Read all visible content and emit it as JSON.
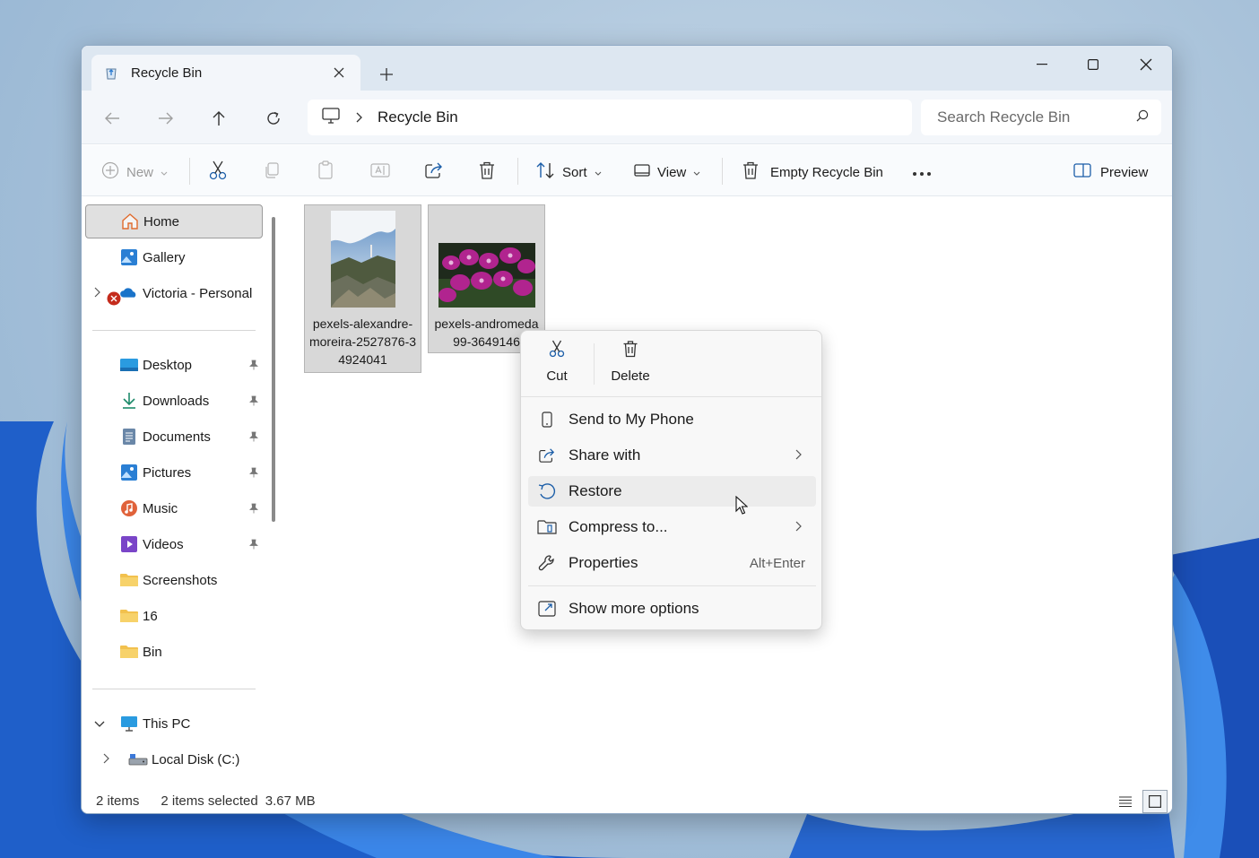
{
  "window": {
    "tab_title": "Recycle Bin",
    "breadcrumb": "Recycle Bin",
    "search_placeholder": "Search Recycle Bin"
  },
  "toolbar": {
    "new_label": "New",
    "sort_label": "Sort",
    "view_label": "View",
    "empty_label": "Empty Recycle Bin",
    "preview_label": "Preview"
  },
  "sidebar": {
    "home": "Home",
    "gallery": "Gallery",
    "onedrive": "Victoria - Personal",
    "desktop": "Desktop",
    "downloads": "Downloads",
    "documents": "Documents",
    "pictures": "Pictures",
    "music": "Music",
    "videos": "Videos",
    "screenshots": "Screenshots",
    "folder16": "16",
    "bin": "Bin",
    "thispc": "This PC",
    "localdisk": "Local Disk (C:)"
  },
  "files": [
    {
      "name": "pexels-alexandre-moreira-2527876-34924041"
    },
    {
      "name": "pexels-andromeda99-3649146"
    }
  ],
  "context_menu": {
    "cut": "Cut",
    "delete": "Delete",
    "send_phone": "Send to My Phone",
    "share": "Share with",
    "restore": "Restore",
    "compress": "Compress to...",
    "properties": "Properties",
    "properties_shortcut": "Alt+Enter",
    "more_options": "Show more options"
  },
  "status": {
    "items": "2 items",
    "selected": "2 items selected",
    "size": "3.67 MB"
  },
  "colors": {
    "accent": "#0067c0",
    "onedrive": "#1a73c9",
    "folder": "#f2c14e",
    "error": "#c42b1c"
  }
}
